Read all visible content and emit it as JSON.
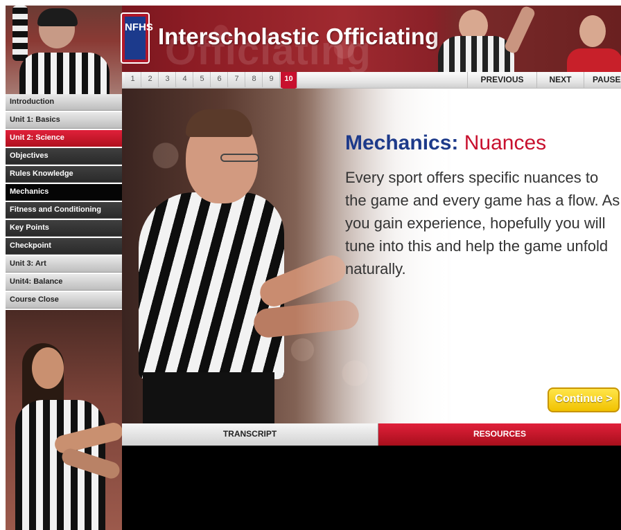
{
  "header": {
    "logo_text": "NFHS",
    "title": "Interscholastic Officiating",
    "watermark": "Officiating"
  },
  "slide_tabs": [
    "1",
    "2",
    "3",
    "4",
    "5",
    "6",
    "7",
    "8",
    "9",
    "10"
  ],
  "active_slide": "10",
  "nav": {
    "previous": "PREVIOUS",
    "next": "NEXT",
    "pause": "PAUSE"
  },
  "sidebar": {
    "items": [
      {
        "label": "Introduction",
        "kind": "unit"
      },
      {
        "label": "Unit 1: Basics",
        "kind": "unit"
      },
      {
        "label": "Unit 2: Science",
        "kind": "current-unit"
      },
      {
        "label": "Objectives",
        "kind": "sub"
      },
      {
        "label": "Rules Knowledge",
        "kind": "sub"
      },
      {
        "label": "Mechanics",
        "kind": "current"
      },
      {
        "label": "Fitness and Conditioning",
        "kind": "sub"
      },
      {
        "label": "Key Points",
        "kind": "sub"
      },
      {
        "label": "Checkpoint",
        "kind": "sub"
      },
      {
        "label": "Unit 3: Art",
        "kind": "unit"
      },
      {
        "label": "Unit4: Balance",
        "kind": "unit"
      },
      {
        "label": "Course Close",
        "kind": "unit"
      }
    ]
  },
  "slide": {
    "heading_main": "Mechanics:",
    "heading_sub": "Nuances",
    "body": "Every sport offers specific nuances to the game and every game has a flow. As you gain experience, hopefully you will tune into this and help the game unfold naturally.",
    "continue_label": "Continue >"
  },
  "bottom_tabs": {
    "transcript": "TRANSCRIPT",
    "resources": "RESOURCES"
  },
  "colors": {
    "brand_red": "#c8102e",
    "brand_blue": "#1d3a8a",
    "continue_yellow": "#f1c200"
  }
}
